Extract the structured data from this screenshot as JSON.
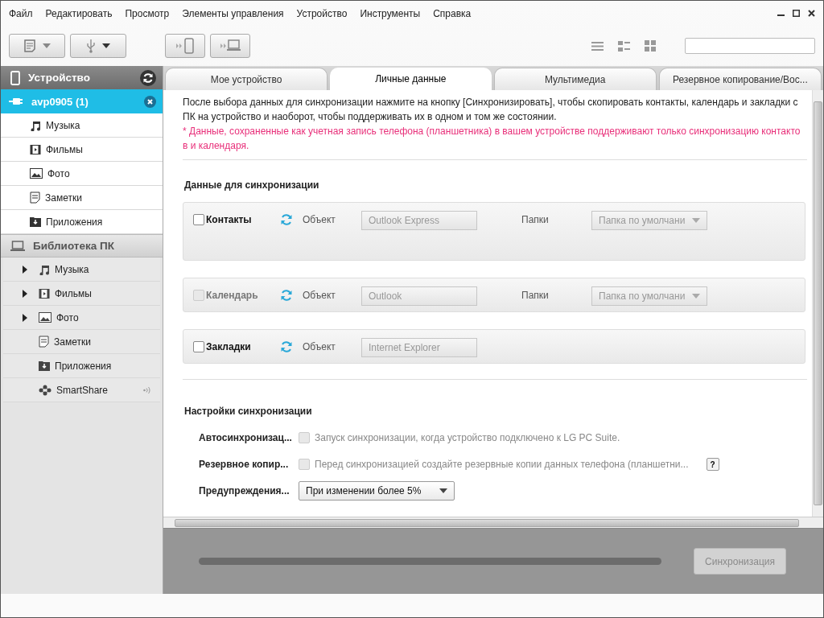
{
  "menu": [
    "Файл",
    "Редактировать",
    "Просмотр",
    "Элементы управления",
    "Устройство",
    "Инструменты",
    "Справка"
  ],
  "sidebar": {
    "device_title": "Устройство",
    "device": {
      "name": "avp0905 (1)",
      "selected": true
    },
    "device_items": [
      {
        "label": "Музыка",
        "kind": "music"
      },
      {
        "label": "Фильмы",
        "kind": "movies"
      },
      {
        "label": "Фото",
        "kind": "photo"
      },
      {
        "label": "Заметки",
        "kind": "notes"
      },
      {
        "label": "Приложения",
        "kind": "apps"
      }
    ],
    "library_title": "Библиотека ПК",
    "library_items": [
      {
        "label": "Музыка",
        "kind": "music",
        "expandable": true
      },
      {
        "label": "Фильмы",
        "kind": "movies",
        "expandable": true
      },
      {
        "label": "Фото",
        "kind": "photo",
        "expandable": true
      },
      {
        "label": "Заметки",
        "kind": "notes",
        "expandable": false
      },
      {
        "label": "Приложения",
        "kind": "apps",
        "expandable": false
      },
      {
        "label": "SmartShare",
        "kind": "smartshare",
        "expandable": false
      }
    ]
  },
  "tabs": [
    {
      "label": "Мое устройство",
      "selected": false
    },
    {
      "label": "Личные данные",
      "selected": true
    },
    {
      "label": "Мультимедиа",
      "selected": false
    },
    {
      "label": "Резервное копирование/Вос...",
      "selected": false
    }
  ],
  "intro": {
    "text": "После выбора данных для синхронизации нажмите на кнопку [Синхронизировать], чтобы скопировать контакты, календарь и закладки с ПК на устройство и наоборот, чтобы поддерживать их в одном и том же состоянии.",
    "note": "* Данные, сохраненные как учетная запись телефона (планшетника) в вашем устройстве поддерживают только синхронизацию контактов и календаря."
  },
  "sync_data": {
    "title": "Данные для синхронизации",
    "items": [
      {
        "label": "Контакты",
        "checked": false,
        "disabled": false,
        "object_label": "Объект",
        "object_value": "Outlook Express",
        "folder_label": "Папки",
        "folder_value": "Папка по умолчани",
        "tall": true
      },
      {
        "label": "Календарь",
        "checked": false,
        "disabled": true,
        "object_label": "Объект",
        "object_value": "Outlook",
        "folder_label": "Папки",
        "folder_value": "Папка по умолчани",
        "tall": false
      },
      {
        "label": "Закладки",
        "checked": false,
        "disabled": false,
        "object_label": "Объект",
        "object_value": "Internet Explorer",
        "tall": false
      }
    ]
  },
  "settings": {
    "title": "Настройки синхронизации",
    "rows": [
      {
        "kind": "checkbox",
        "label": "Автосинхронизац...",
        "text": "Запуск синхронизации, когда устройство подключено к LG PC Suite.",
        "checked": false,
        "disabled": true,
        "help": false
      },
      {
        "kind": "checkbox",
        "label": "Резервное копир...",
        "text": "Перед синхронизацией создайте резервные копии данных телефона (планшетни...",
        "checked": false,
        "disabled": true,
        "help": true,
        "help_label": "?"
      },
      {
        "kind": "select",
        "label": "Предупреждения...",
        "value": "При изменении более 5%"
      }
    ]
  },
  "footer": {
    "progress": {
      "level": 0
    },
    "sync_button": {
      "label": "Синхронизация",
      "disabled": true
    }
  }
}
